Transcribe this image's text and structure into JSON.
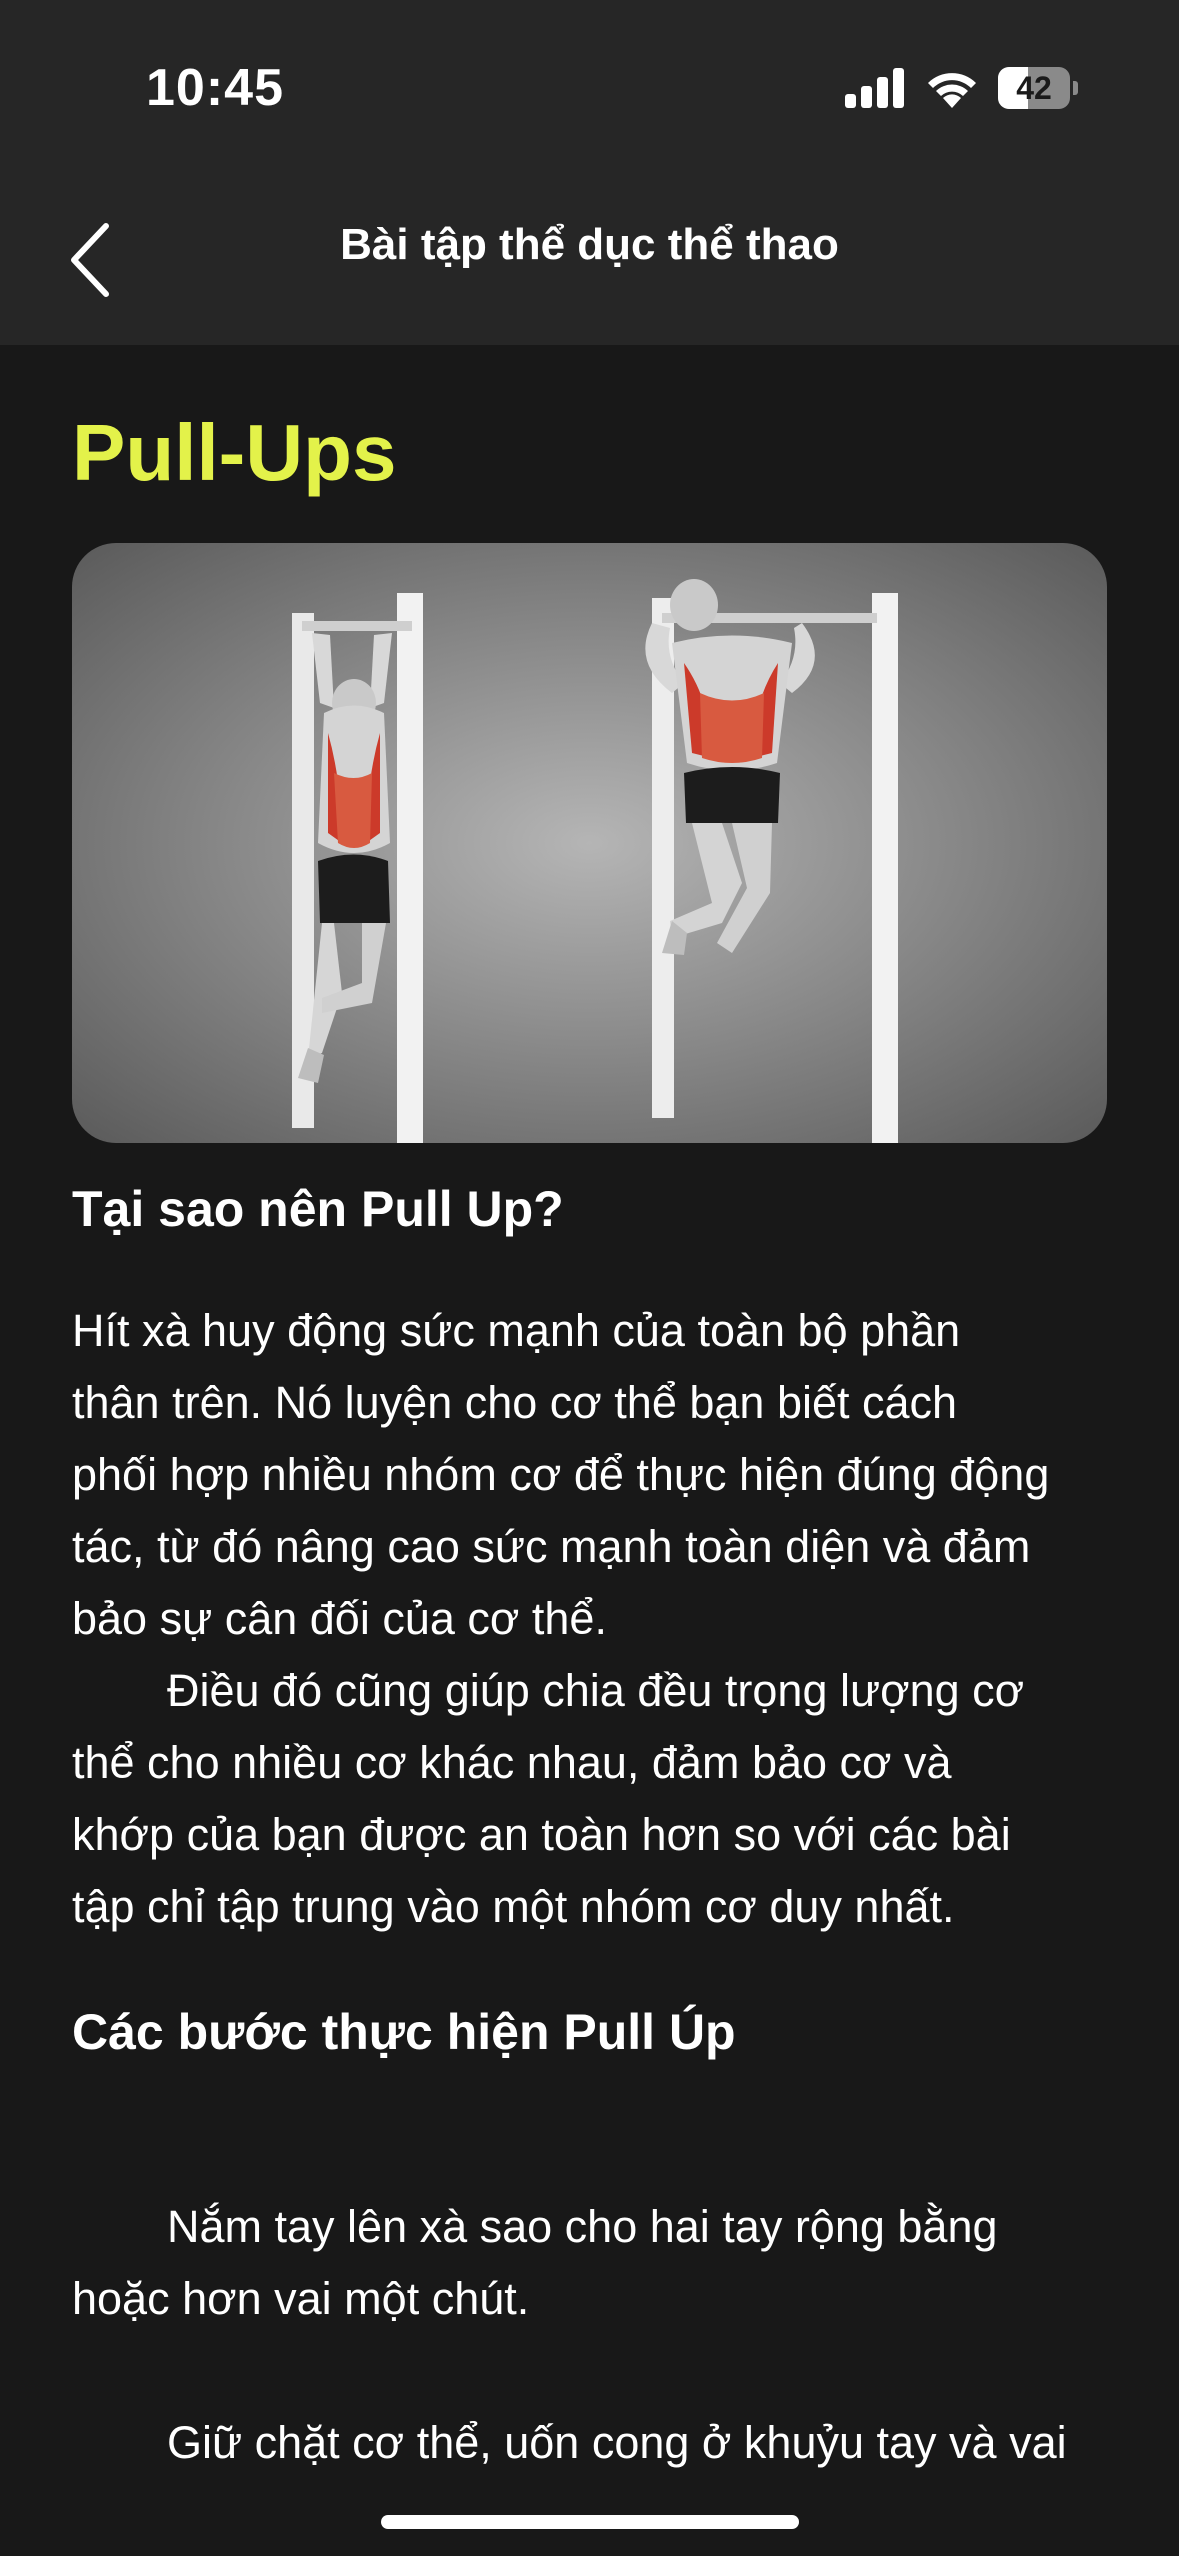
{
  "status_bar": {
    "time": "10:45",
    "battery_level": "42",
    "battery_fraction": 0.42
  },
  "nav": {
    "title": "Bài tập thể dục thể thao",
    "back_icon": "chevron-left-icon"
  },
  "exercise": {
    "title": "Pull-Ups",
    "title_color": "#e3f24a"
  },
  "why_section": {
    "heading": "Tại sao nên Pull Up?",
    "lines": [
      "Hít xà huy động sức mạnh của toàn bộ phần",
      "thân trên. Nó luyện cho cơ thể bạn biết cách",
      "phối hợp nhiều nhóm cơ để thực hiện đúng động",
      "tác, từ đó nâng cao sức mạnh toàn diện và đảm",
      "bảo sự cân đối của cơ thể.",
      "Điều đó cũng giúp chia đều trọng lượng cơ",
      "thể cho nhiều cơ khác nhau, đảm bảo cơ và",
      "khớp của bạn được an toàn hơn so với các bài",
      "tập chỉ tập trung vào một nhóm cơ duy nhất."
    ]
  },
  "steps_section": {
    "heading": "Các bước thực hiện Pull Úp",
    "step1_lines": [
      "Nắm tay lên xà sao cho hai tay rộng bằng",
      "hoặc hơn vai một chút."
    ],
    "step2_lines": [
      "Giữ chặt cơ thể, uốn cong ở khuỷu tay và vai"
    ]
  }
}
